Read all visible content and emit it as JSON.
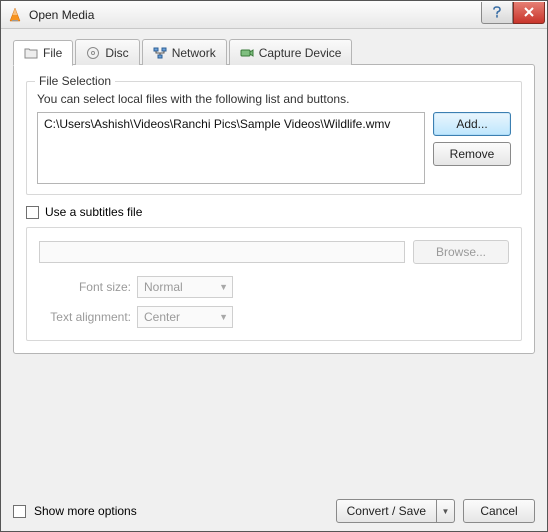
{
  "window": {
    "title": "Open Media"
  },
  "tabs": {
    "file": "File",
    "disc": "Disc",
    "network": "Network",
    "capture": "Capture Device"
  },
  "fileSelection": {
    "title": "File Selection",
    "desc": "You can select local files with the following list and buttons.",
    "items": [
      "C:\\Users\\Ashish\\Videos\\Ranchi Pics\\Sample Videos\\Wildlife.wmv"
    ],
    "add": "Add...",
    "remove": "Remove"
  },
  "subtitles": {
    "use_label": "Use a subtitles file",
    "browse": "Browse...",
    "font_label": "Font size:",
    "font_value": "Normal",
    "align_label": "Text alignment:",
    "align_value": "Center"
  },
  "bottom": {
    "show_more": "Show more options",
    "convert": "Convert / Save",
    "cancel": "Cancel"
  }
}
